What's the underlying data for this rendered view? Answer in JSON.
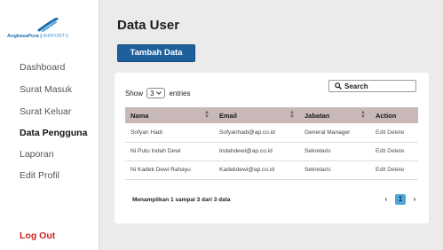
{
  "sidebar": {
    "logo": {
      "brand": "AngkasaPura",
      "sub": "AIRPORTS"
    },
    "items": [
      {
        "label": "Dashboard"
      },
      {
        "label": "Surat Masuk"
      },
      {
        "label": "Surat Keluar"
      },
      {
        "label": "Data Pengguna"
      },
      {
        "label": "Laporan"
      },
      {
        "label": "Edit Profil"
      }
    ],
    "logout": "Log Out"
  },
  "main": {
    "title": "Data User",
    "add_button": "Tambah Data",
    "show_label": "Show",
    "entries_value": "3",
    "entries_label": "entries",
    "search_placeholder": "Search",
    "columns": [
      "Nama",
      "Email",
      "Jabatan",
      "Action"
    ],
    "rows": [
      {
        "nama": "Sofyan Hadi",
        "email": "Sofyanhadi@ap.co.id",
        "jabatan": "General Manager",
        "edit": "Edit",
        "delete": "Delete"
      },
      {
        "nama": "Ni Putu Indah Dewi",
        "email": "Indahdewi@ap.co.id",
        "jabatan": "Sekretaris",
        "edit": "Edit",
        "delete": "Delete"
      },
      {
        "nama": "Ni Kadek Dewi Rahayu",
        "email": "Kadekdewi@ap.co.id",
        "jabatan": "Sekretaris",
        "edit": "Edit",
        "delete": "Delete"
      }
    ],
    "info": "Menampilkan 1 sampai 3 dari 3 data",
    "pager": {
      "prev": "‹",
      "current": "1",
      "next": "›"
    }
  },
  "colors": {
    "accent": "#1f5f9b",
    "header_bg": "#c9b8b8",
    "logout": "#cc2222",
    "page_active": "#4fa6d8"
  }
}
